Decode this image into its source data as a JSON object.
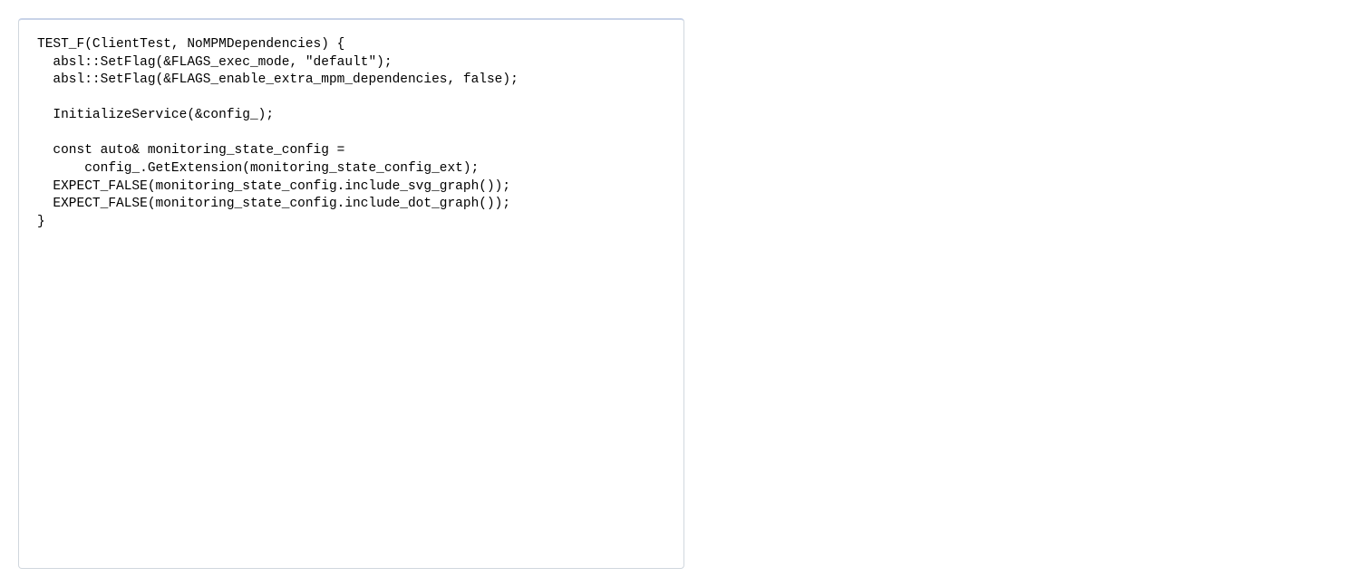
{
  "code": {
    "line1": "TEST_F(ClientTest, NoMPMDependencies) {",
    "line2": "  absl::SetFlag(&FLAGS_exec_mode, \"default\");",
    "line3": "  absl::SetFlag(&FLAGS_enable_extra_mpm_dependencies, false);",
    "line4": "",
    "line5": "  InitializeService(&config_);",
    "line6": "",
    "line7": "  const auto& monitoring_state_config =",
    "line8": "      config_.GetExtension(monitoring_state_config_ext);",
    "line9": "  EXPECT_FALSE(monitoring_state_config.include_svg_graph());",
    "line10": "  EXPECT_FALSE(monitoring_state_config.include_dot_graph());",
    "line11": "}"
  }
}
